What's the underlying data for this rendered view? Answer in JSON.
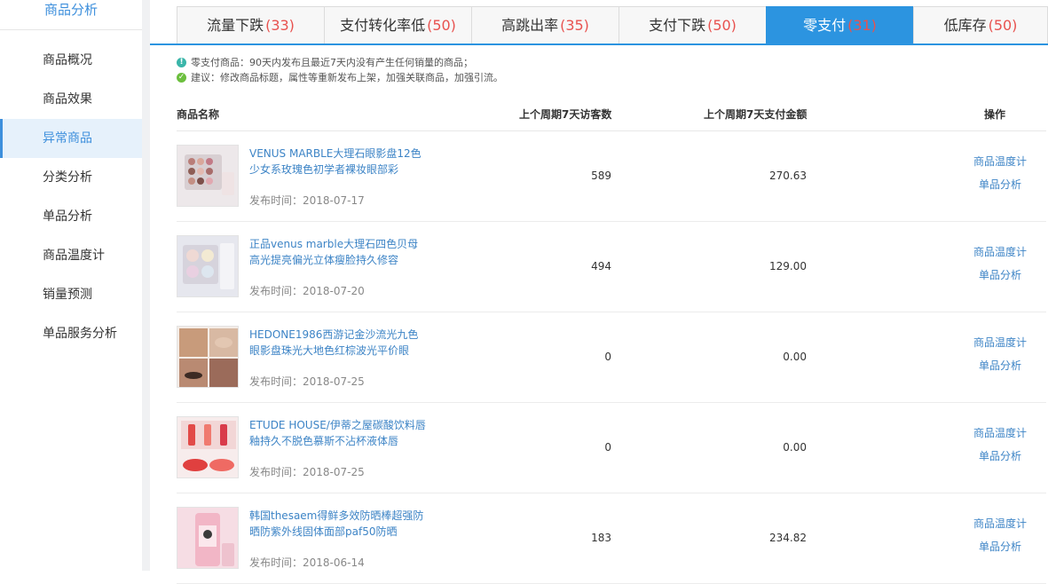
{
  "sidebar": {
    "title": "商品分析",
    "items": [
      {
        "label": "商品概况"
      },
      {
        "label": "商品效果"
      },
      {
        "label": "异常商品",
        "active": true
      },
      {
        "label": "分类分析"
      },
      {
        "label": "单品分析"
      },
      {
        "label": "商品温度计"
      },
      {
        "label": "销量预测"
      },
      {
        "label": "单品服务分析"
      }
    ]
  },
  "tabs": [
    {
      "label": "流量下跌",
      "count": "(33)"
    },
    {
      "label": "支付转化率低",
      "count": "(50)"
    },
    {
      "label": "高跳出率",
      "count": "(35)"
    },
    {
      "label": "支付下跌",
      "count": "(50)"
    },
    {
      "label": "零支付",
      "count": "(31)",
      "active": true
    },
    {
      "label": "低库存",
      "count": "(50)"
    }
  ],
  "notes": {
    "info": "零支付商品：90天内发布且最近7天内没有产生任何销量的商品；",
    "advice": "建议：修改商品标题，属性等重新发布上架，加强关联商品，加强引流。"
  },
  "table": {
    "headers": {
      "name": "商品名称",
      "visitors": "上个周期7天访客数",
      "amount": "上个周期7天支付金额",
      "ops": "操作"
    },
    "op_labels": {
      "thermometer": "商品温度计",
      "analysis": "单品分析"
    },
    "rows": [
      {
        "name": "VENUS MARBLE大理石眼影盘12色少女系玫瑰色初学者裸妆眼部彩",
        "date": "发布时间：2018-07-17",
        "visitors": "589",
        "amount": "270.63",
        "thumb": "eyeshadow-palette"
      },
      {
        "name": "正品venus marble大理石四色贝母高光提亮偏光立体瘦脸持久修容",
        "date": "发布时间：2018-07-20",
        "visitors": "494",
        "amount": "129.00",
        "thumb": "highlighter-palette"
      },
      {
        "name": "HEDONE1986西游记金沙流光九色眼影盘珠光大地色红棕波光平价眼",
        "date": "发布时间：2018-07-25",
        "visitors": "0",
        "amount": "0.00",
        "thumb": "eye-makeup"
      },
      {
        "name": "ETUDE HOUSE/伊蒂之屋碳酸饮料唇釉持久不脱色慕斯不沾杯液体唇",
        "date": "发布时间：2018-07-25",
        "visitors": "0",
        "amount": "0.00",
        "thumb": "lip-gloss"
      },
      {
        "name": "韩国thesaem得鲜多效防晒棒超强防晒防紫外线固体面部paf50防晒",
        "date": "发布时间：2018-06-14",
        "visitors": "183",
        "amount": "234.82",
        "thumb": "sunscreen-stick"
      }
    ]
  }
}
